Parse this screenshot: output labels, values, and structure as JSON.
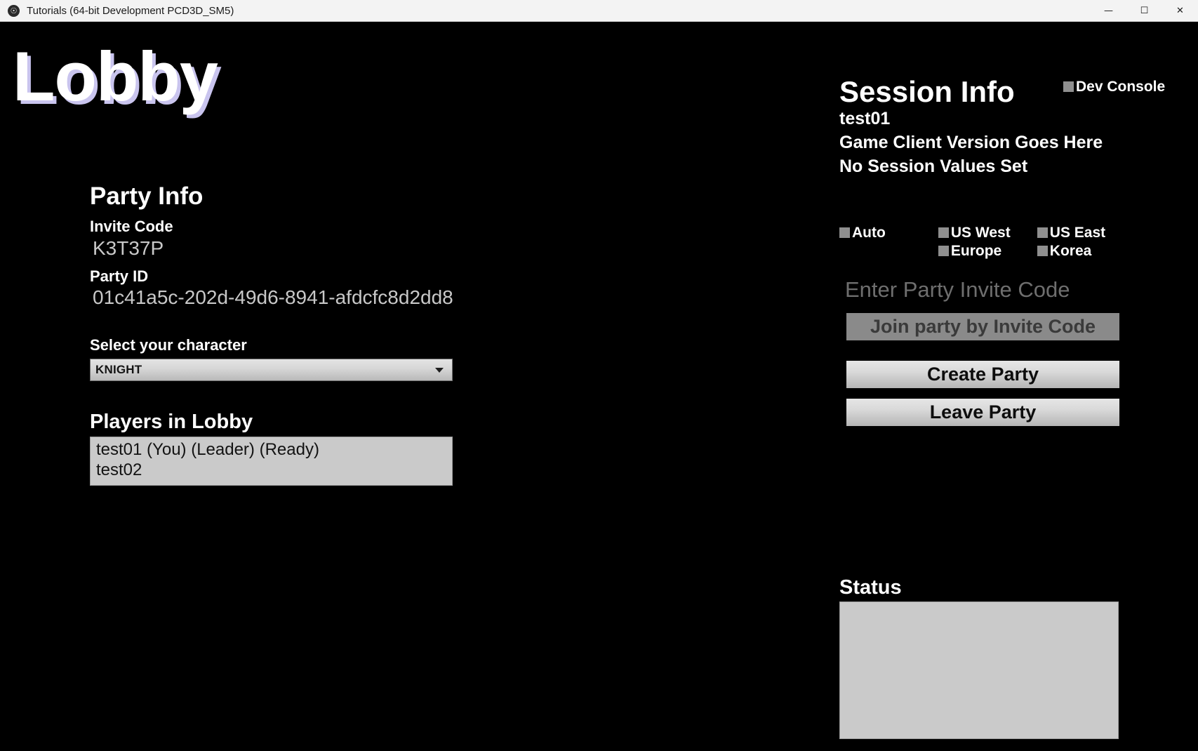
{
  "window": {
    "title": "Tutorials (64-bit Development PCD3D_SM5)",
    "icon": "unreal-engine-icon",
    "controls": {
      "minimize": "—",
      "maximize": "☐",
      "close": "✕"
    }
  },
  "screen": {
    "heading": "Lobby",
    "background_color": "#000000",
    "heading_shadow_color": "#c9c4ee"
  },
  "party_info": {
    "heading": "Party Info",
    "invite_code_label": "Invite Code",
    "invite_code_value": "K3T37P",
    "party_id_label": "Party ID",
    "party_id_value": "01c41a5c-202d-49d6-8941-afdcfc8d2dd8",
    "character_select_label": "Select your character",
    "character_select_value": "KNIGHT",
    "character_options": [
      "KNIGHT"
    ],
    "players_heading": "Players in Lobby",
    "players": [
      "test01 (You) (Leader) (Ready)",
      "test02"
    ]
  },
  "session_info": {
    "heading": "Session Info",
    "player_name": "test01",
    "client_version": "Game Client Version Goes Here",
    "session_values": "No Session Values Set",
    "dev_console_label": "Dev Console",
    "regions": [
      {
        "label": "Auto",
        "checked": false
      },
      {
        "label": "US West",
        "checked": false
      },
      {
        "label": "US East",
        "checked": false
      },
      {
        "label": "Europe",
        "checked": false
      },
      {
        "label": "Korea",
        "checked": false
      }
    ],
    "invite_input_placeholder": "Enter Party Invite Code",
    "invite_input_value": "",
    "join_party_label": "Join party by Invite Code",
    "create_party_label": "Create Party",
    "leave_party_label": "Leave Party",
    "status_heading": "Status",
    "status_text": ""
  }
}
